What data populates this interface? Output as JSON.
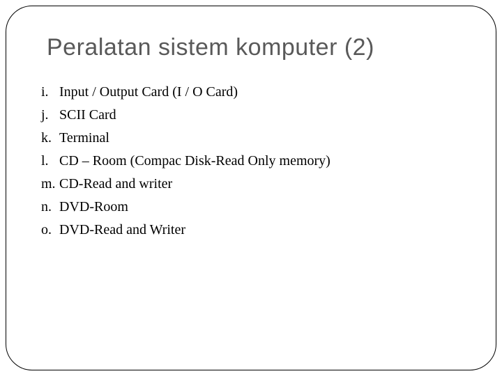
{
  "title": "Peralatan sistem  komputer (2)",
  "items": [
    {
      "marker": "i.",
      "text": "Input / Output Card (I / O Card)"
    },
    {
      "marker": "j.",
      "text": "SCII Card"
    },
    {
      "marker": "k.",
      "text": "Terminal"
    },
    {
      "marker": "l.",
      "text": "CD – Room (Compac Disk-Read Only memory)"
    },
    {
      "marker": "m.",
      "text": "CD-Read and writer"
    },
    {
      "marker": "n.",
      "text": "DVD-Room"
    },
    {
      "marker": "o.",
      "text": "DVD-Read and Writer"
    }
  ],
  "footer": ""
}
